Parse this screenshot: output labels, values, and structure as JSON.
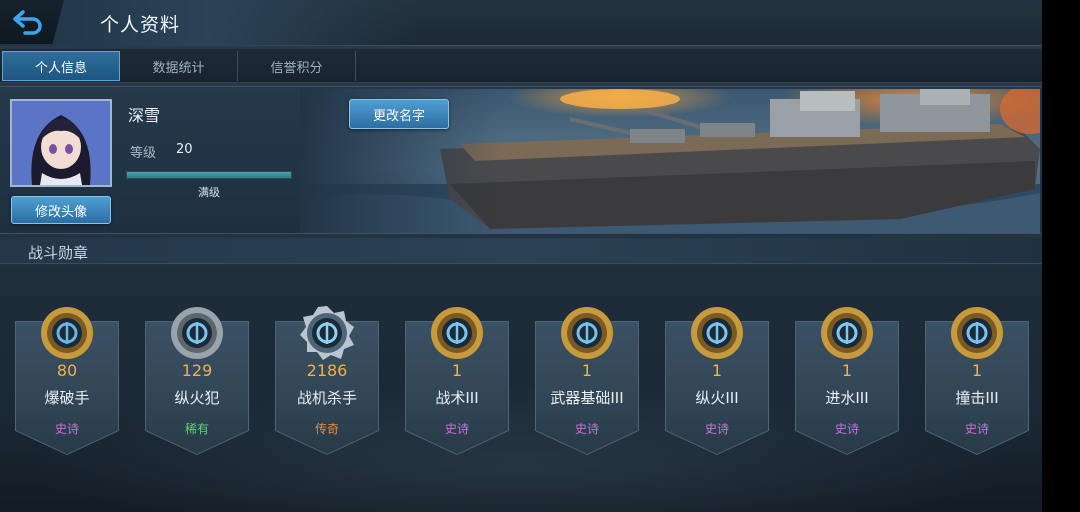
{
  "header": {
    "title": "个人资料"
  },
  "tabs": [
    {
      "label": "个人信息",
      "active": true
    },
    {
      "label": "数据统计",
      "active": false
    },
    {
      "label": "信誉积分",
      "active": false
    }
  ],
  "profile": {
    "name": "深雪",
    "level_label": "等级",
    "level_value": "20",
    "xp_status": "满级",
    "xp_fraction": 1.0,
    "change_avatar_label": "修改头像",
    "rename_label": "更改名字"
  },
  "section": {
    "title": "战斗勋章"
  },
  "medals": [
    {
      "count": "80",
      "name": "爆破手",
      "rarity": "史诗",
      "rarity_class": "epic",
      "icon": "demolition-medal-icon"
    },
    {
      "count": "129",
      "name": "纵火犯",
      "rarity": "稀有",
      "rarity_class": "rare",
      "icon": "arsonist-medal-icon"
    },
    {
      "count": "2186",
      "name": "战机杀手",
      "rarity": "传奇",
      "rarity_class": "legend",
      "icon": "aircraft-killer-medal-icon"
    },
    {
      "count": "1",
      "name": "战术III",
      "rarity": "史诗",
      "rarity_class": "epic",
      "icon": "tactics-medal-icon"
    },
    {
      "count": "1",
      "name": "武器基础III",
      "rarity": "史诗",
      "rarity_class": "epic",
      "icon": "weapon-basics-medal-icon"
    },
    {
      "count": "1",
      "name": "纵火III",
      "rarity": "史诗",
      "rarity_class": "epic",
      "icon": "arson-medal-icon"
    },
    {
      "count": "1",
      "name": "进水III",
      "rarity": "史诗",
      "rarity_class": "epic",
      "icon": "flooding-medal-icon"
    },
    {
      "count": "1",
      "name": "撞击III",
      "rarity": "史诗",
      "rarity_class": "epic",
      "icon": "ramming-medal-icon"
    }
  ],
  "colors": {
    "epic": "#c673e0",
    "rare": "#64d36a",
    "legend": "#ee8a3a",
    "count": "#f0b14a",
    "accent": "#2d6f9c"
  }
}
